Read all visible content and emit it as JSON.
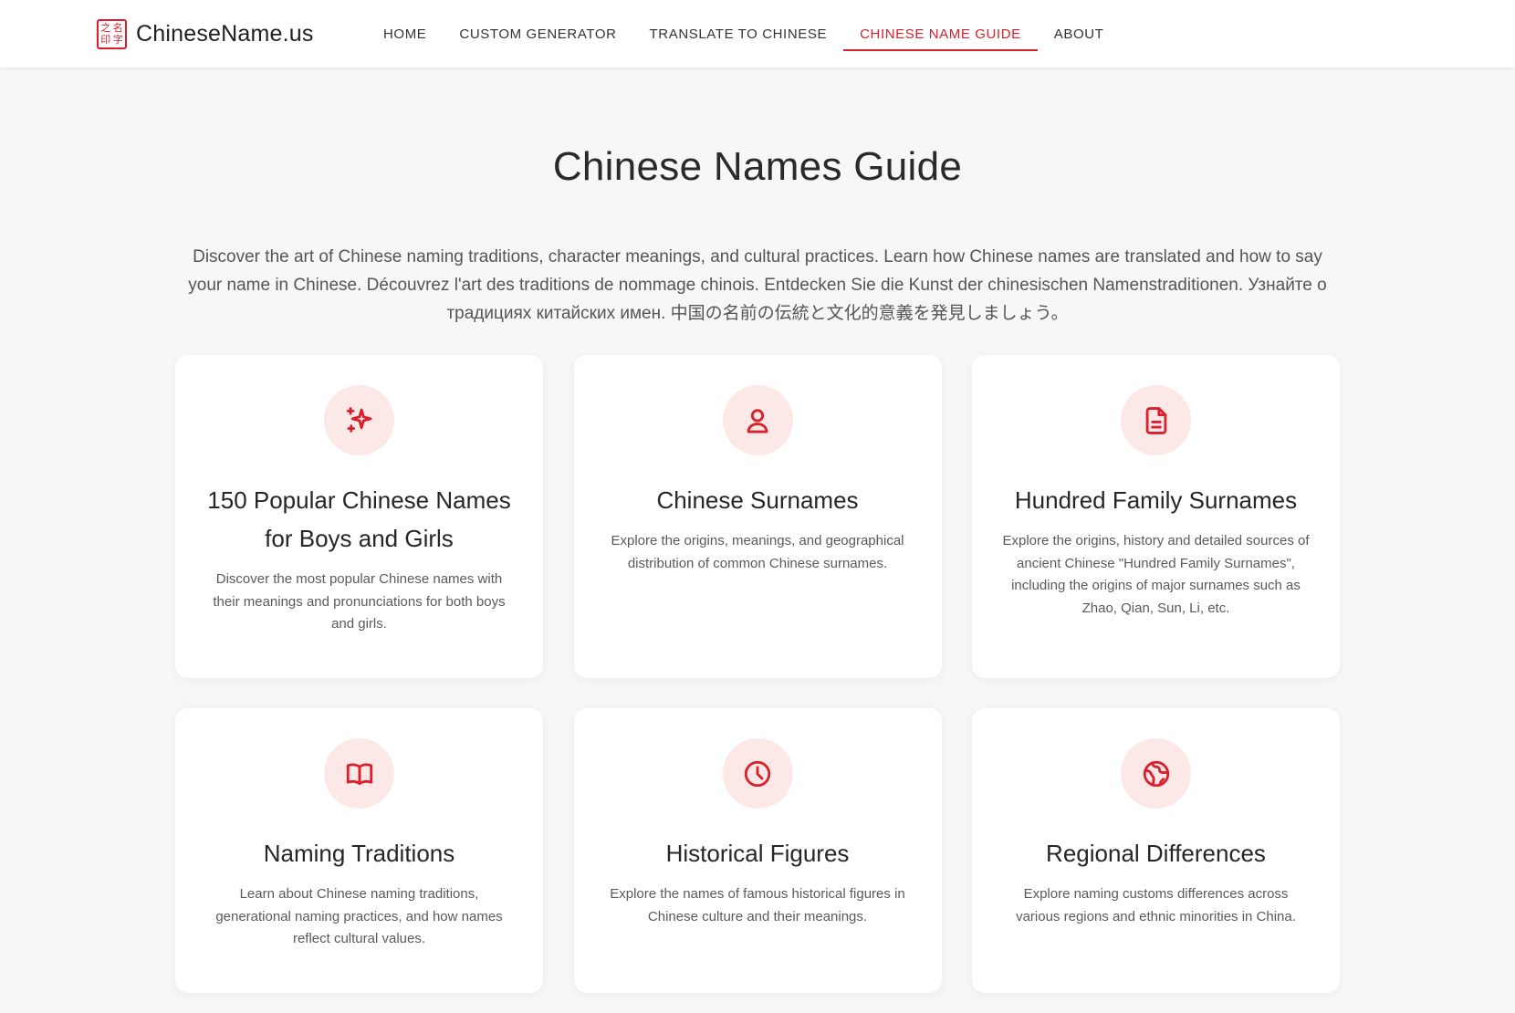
{
  "brand": {
    "name": "ChineseName.us",
    "seal_chars": [
      "之",
      "名",
      "印",
      "字"
    ],
    "accent_color": "#d9202c"
  },
  "nav": {
    "items": [
      {
        "label": "HOME",
        "active": false
      },
      {
        "label": "CUSTOM GENERATOR",
        "active": false
      },
      {
        "label": "TRANSLATE TO CHINESE",
        "active": false
      },
      {
        "label": "CHINESE NAME GUIDE",
        "active": true
      },
      {
        "label": "ABOUT",
        "active": false
      }
    ]
  },
  "hero": {
    "title": "Chinese Names Guide",
    "intro": "Discover the art of Chinese naming traditions, character meanings, and cultural practices. Learn how Chinese names are translated and how to say your name in Chinese. Découvrez l'art des traditions de nommage chinois. Entdecken Sie die Kunst der chinesischen Namenstraditionen. Узнайте о традициях китайских имен. 中国の名前の伝統と文化的意義を発見しましょう。"
  },
  "cards": [
    {
      "icon": "sparkles-icon",
      "title": "150 Popular Chinese Names for Boys and Girls",
      "description": "Discover the most popular Chinese names with their meanings and pronunciations for both boys and girls."
    },
    {
      "icon": "user-icon",
      "title": "Chinese Surnames",
      "description": "Explore the origins, meanings, and geographical distribution of common Chinese surnames."
    },
    {
      "icon": "document-icon",
      "title": "Hundred Family Surnames",
      "description": "Explore the origins, history and detailed sources of ancient Chinese \"Hundred Family Surnames\", including the origins of major surnames such as Zhao, Qian, Sun, Li, etc."
    },
    {
      "icon": "book-open-icon",
      "title": "Naming Traditions",
      "description": "Learn about Chinese naming traditions, generational naming practices, and how names reflect cultural values."
    },
    {
      "icon": "clock-icon",
      "title": "Historical Figures",
      "description": "Explore the names of famous historical figures in Chinese culture and their meanings."
    },
    {
      "icon": "globe-icon",
      "title": "Regional Differences",
      "description": "Explore naming customs differences across various regions and ethnic minorities in China."
    }
  ]
}
